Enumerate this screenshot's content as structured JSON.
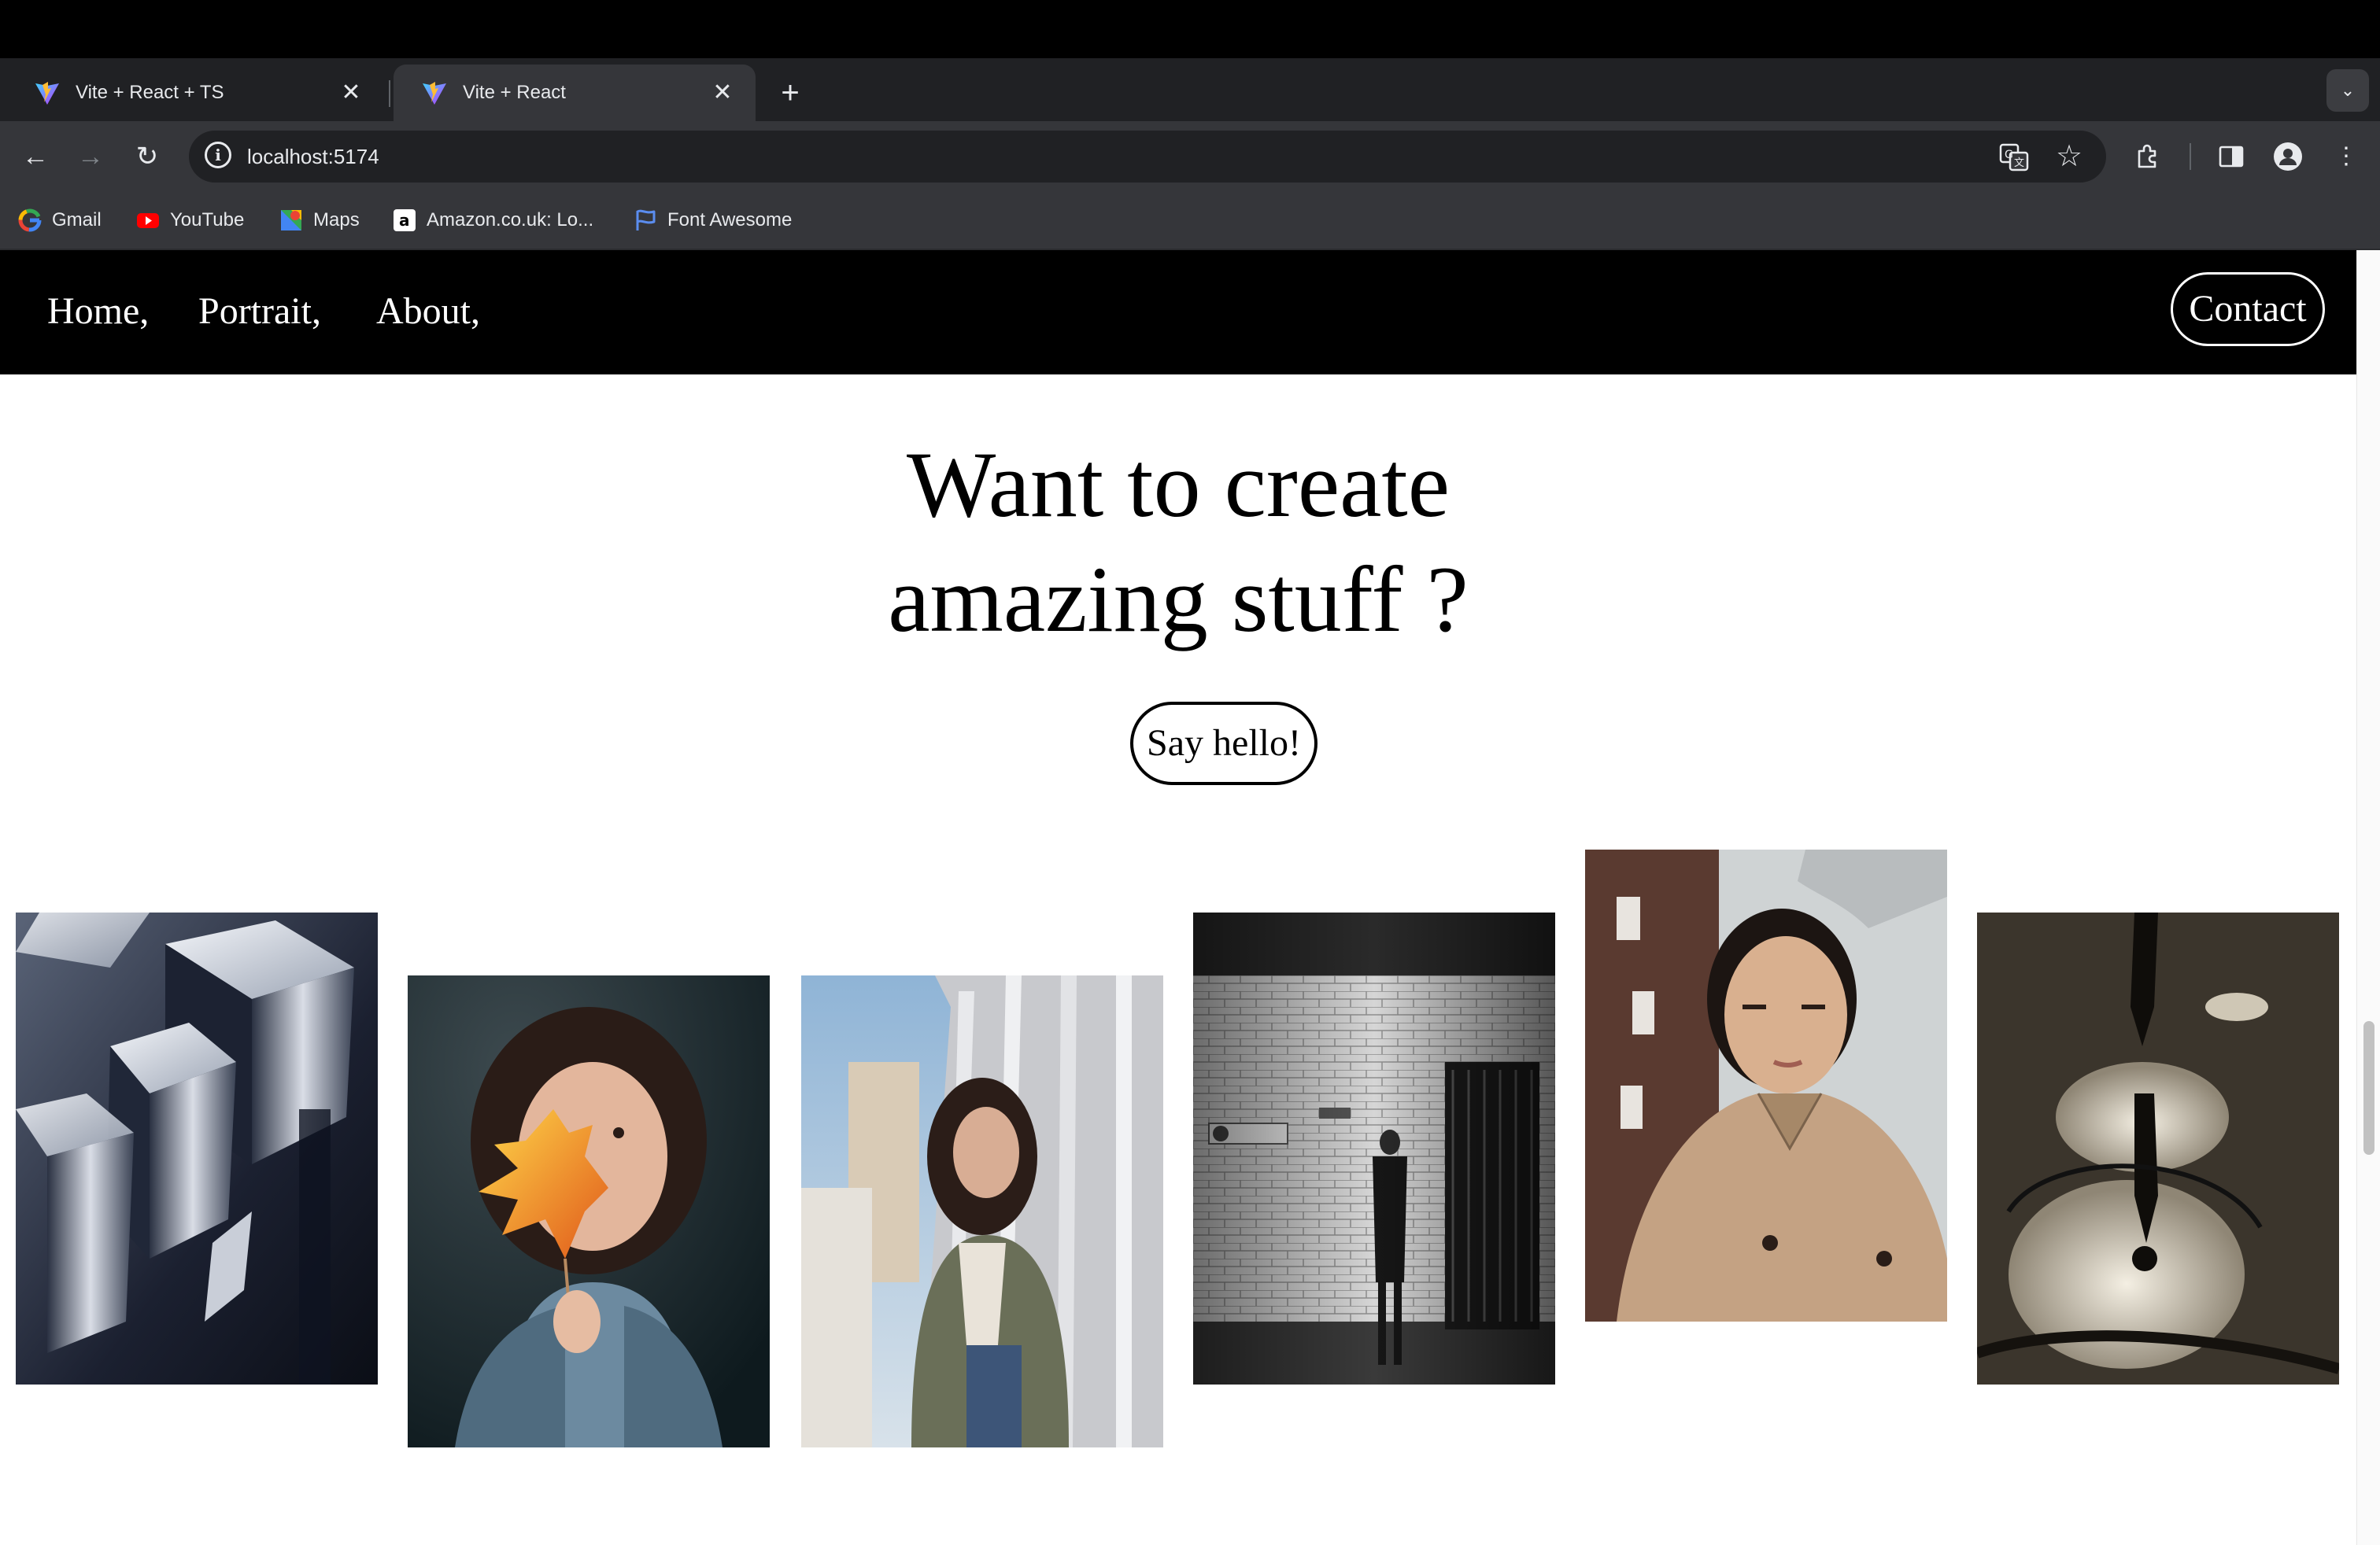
{
  "browser": {
    "tabs": [
      {
        "title": "Vite + React + TS",
        "active": false
      },
      {
        "title": "Vite + React",
        "active": true
      }
    ],
    "new_tab_icon": "plus-icon",
    "address": "localhost:5174",
    "bookmarks": [
      {
        "label": "Gmail",
        "icon": "google-icon"
      },
      {
        "label": "YouTube",
        "icon": "youtube-icon"
      },
      {
        "label": "Maps",
        "icon": "maps-icon"
      },
      {
        "label": "Amazon.co.uk: Lo...",
        "icon": "amazon-icon"
      },
      {
        "label": "Font Awesome",
        "icon": "flag-icon"
      }
    ]
  },
  "site": {
    "nav": {
      "links": [
        "Home,",
        "Portrait,",
        "About,"
      ],
      "contact": "Contact"
    },
    "hero": {
      "line1": "Want to create",
      "line2": "amazing stuff ?",
      "button": "Say hello!"
    },
    "gallery": [
      {
        "subject": "chrome cubes"
      },
      {
        "subject": "woman holding autumn leaf"
      },
      {
        "subject": "woman leaning on wall"
      },
      {
        "subject": "man standing by brick wall"
      },
      {
        "subject": "man in beige coat"
      },
      {
        "subject": "reflection in puddle"
      }
    ]
  },
  "colors": {
    "chrome_bg": "#202124",
    "toolbar_bg": "#35363a",
    "site_nav_bg": "#000000",
    "page_bg": "#ffffff"
  }
}
